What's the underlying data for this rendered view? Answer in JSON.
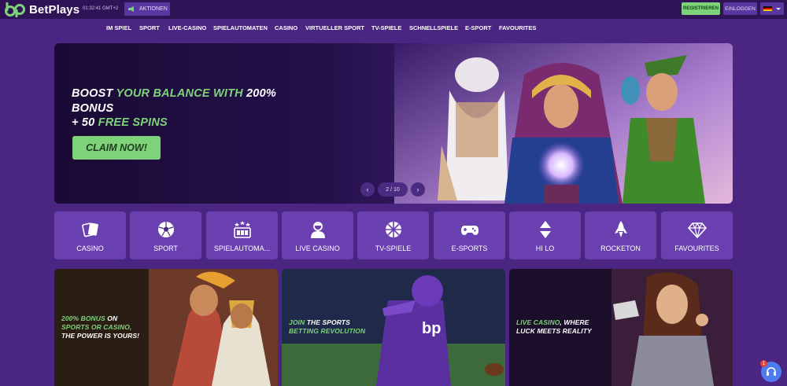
{
  "header": {
    "brand": "BetPlays",
    "time": "01:32:41",
    "timezone": "GMT+2",
    "promotions_label": "AKTIONEN",
    "register_label": "REGISTRIEREN",
    "login_label": "EINLOGGEN",
    "language_icon": "german-flag-icon"
  },
  "nav": {
    "items": [
      "IM SPIEL",
      "SPORT",
      "LIVE-CASINO",
      "SPIELAUTOMATEN",
      "CASINO",
      "VIRTUELLER SPORT",
      "TV-SPIELE",
      "SCHNELLSPIELE",
      "E-SPORT",
      "FAVOURITES"
    ]
  },
  "hero": {
    "title_part1": "BOOST ",
    "title_part2": "YOUR BALANCE WITH",
    "title_part3": " 200%",
    "title_line2": "BONUS",
    "title_line3a": "+ 50 ",
    "title_line3b": "FREE SPINS",
    "cta_label": "CLAIM NOW!",
    "pager": "2 / 10",
    "prev_icon": "chevron-left-icon",
    "next_icon": "chevron-right-icon"
  },
  "categories": [
    {
      "label": "CASINO",
      "icon": "cards-icon"
    },
    {
      "label": "SPORT",
      "icon": "soccer-ball-icon"
    },
    {
      "label": "SPIELAUTOMA...",
      "icon": "slot-machine-icon"
    },
    {
      "label": "LIVE CASINO",
      "icon": "dealer-icon"
    },
    {
      "label": "TV-SPIELE",
      "icon": "wheel-icon"
    },
    {
      "label": "E-SPORTS",
      "icon": "gamepad-icon"
    },
    {
      "label": "HI LO",
      "icon": "hi-lo-icon"
    },
    {
      "label": "ROCKETON",
      "icon": "rocket-icon"
    },
    {
      "label": "FAVOURITES",
      "icon": "diamond-icon"
    }
  ],
  "promos": [
    {
      "l1a": "200% BONUS",
      "l1b": " ON",
      "l2": "SPORTS OR CASINO,",
      "l3": "THE POWER IS YOURS!"
    },
    {
      "l1a": "JOIN",
      "l1b": " THE SPORTS",
      "l2": "BETTING REVOLUTION"
    },
    {
      "l1a": "LIVE CASINO",
      "l1b": ", WHERE",
      "l2": "LUCK MEETS REALITY"
    }
  ],
  "chat": {
    "badge": "1"
  },
  "colors": {
    "background": "#4b2582",
    "topbar": "#2e1457",
    "accent_green": "#7ed37a",
    "tile": "#6a40b0"
  }
}
